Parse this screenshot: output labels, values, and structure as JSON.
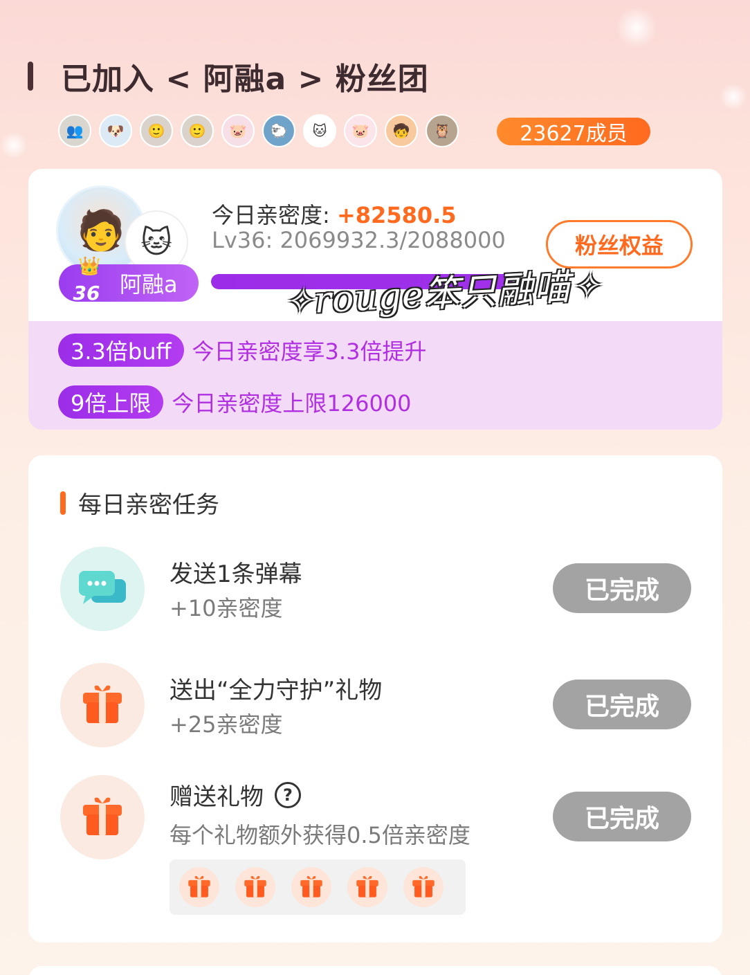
{
  "header": {
    "title": "已加入 < 阿融a > 粉丝团"
  },
  "members": {
    "avatars": [
      {
        "icon": "group-photo-avatar",
        "bg": "#d8d6cf",
        "glyph": "👥"
      },
      {
        "icon": "dog-avatar",
        "bg": "#dceaf6",
        "glyph": "🐶"
      },
      {
        "icon": "person-avatar",
        "bg": "#d9d3cc",
        "glyph": "🙂"
      },
      {
        "icon": "person-avatar",
        "bg": "#d9d3cc",
        "glyph": "🙂"
      },
      {
        "icon": "pig-sticker-avatar",
        "bg": "#f7dfe8",
        "glyph": "🐷"
      },
      {
        "icon": "landscape-avatar",
        "bg": "#6fa3c9",
        "glyph": "🐑"
      },
      {
        "icon": "cat-sticker-avatar",
        "bg": "#ffffff",
        "glyph": "🐱"
      },
      {
        "icon": "pig-sticker-avatar",
        "bg": "#fbe4ea",
        "glyph": "🐷"
      },
      {
        "icon": "cartoon-avatar",
        "bg": "#f7c99c",
        "glyph": "🧒"
      },
      {
        "icon": "character-avatar",
        "bg": "#b6a48f",
        "glyph": "🦉"
      }
    ],
    "count_label": "23627成员"
  },
  "fan_card": {
    "host_name": "阿融a",
    "level_number": "36",
    "intimacy_label": "今日亲密度:",
    "intimacy_value": "+82580.5",
    "level_progress_text": "Lv36: 2069932.3/2088000",
    "level_progress_fraction": 0.991,
    "watermark": "✧rouge笨只融喵✧",
    "perks_button": "粉丝权益",
    "buffs": [
      {
        "pill": "3.3倍buff",
        "desc": "今日亲密度享3.3倍提升"
      },
      {
        "pill": "9倍上限",
        "desc": "今日亲密度上限126000"
      }
    ]
  },
  "tasks": {
    "section_title": "每日亲密任务",
    "items": [
      {
        "title": "发送1条弹幕",
        "sub": "+10亲密度",
        "button": "已完成",
        "icon": "chat-bubble-icon"
      },
      {
        "title": "送出“全力守护”礼物",
        "sub": "+25亲密度",
        "button": "已完成",
        "icon": "gift-box-icon"
      },
      {
        "title": "赠送礼物",
        "sub": "每个礼物额外获得0.5倍亲密度",
        "button": "已完成",
        "icon": "gift-box-icon",
        "help": "?"
      }
    ]
  },
  "colors": {
    "accent": "#ff6a1f",
    "purple": "#9b2de8",
    "done_gray": "#a3a3a3"
  }
}
